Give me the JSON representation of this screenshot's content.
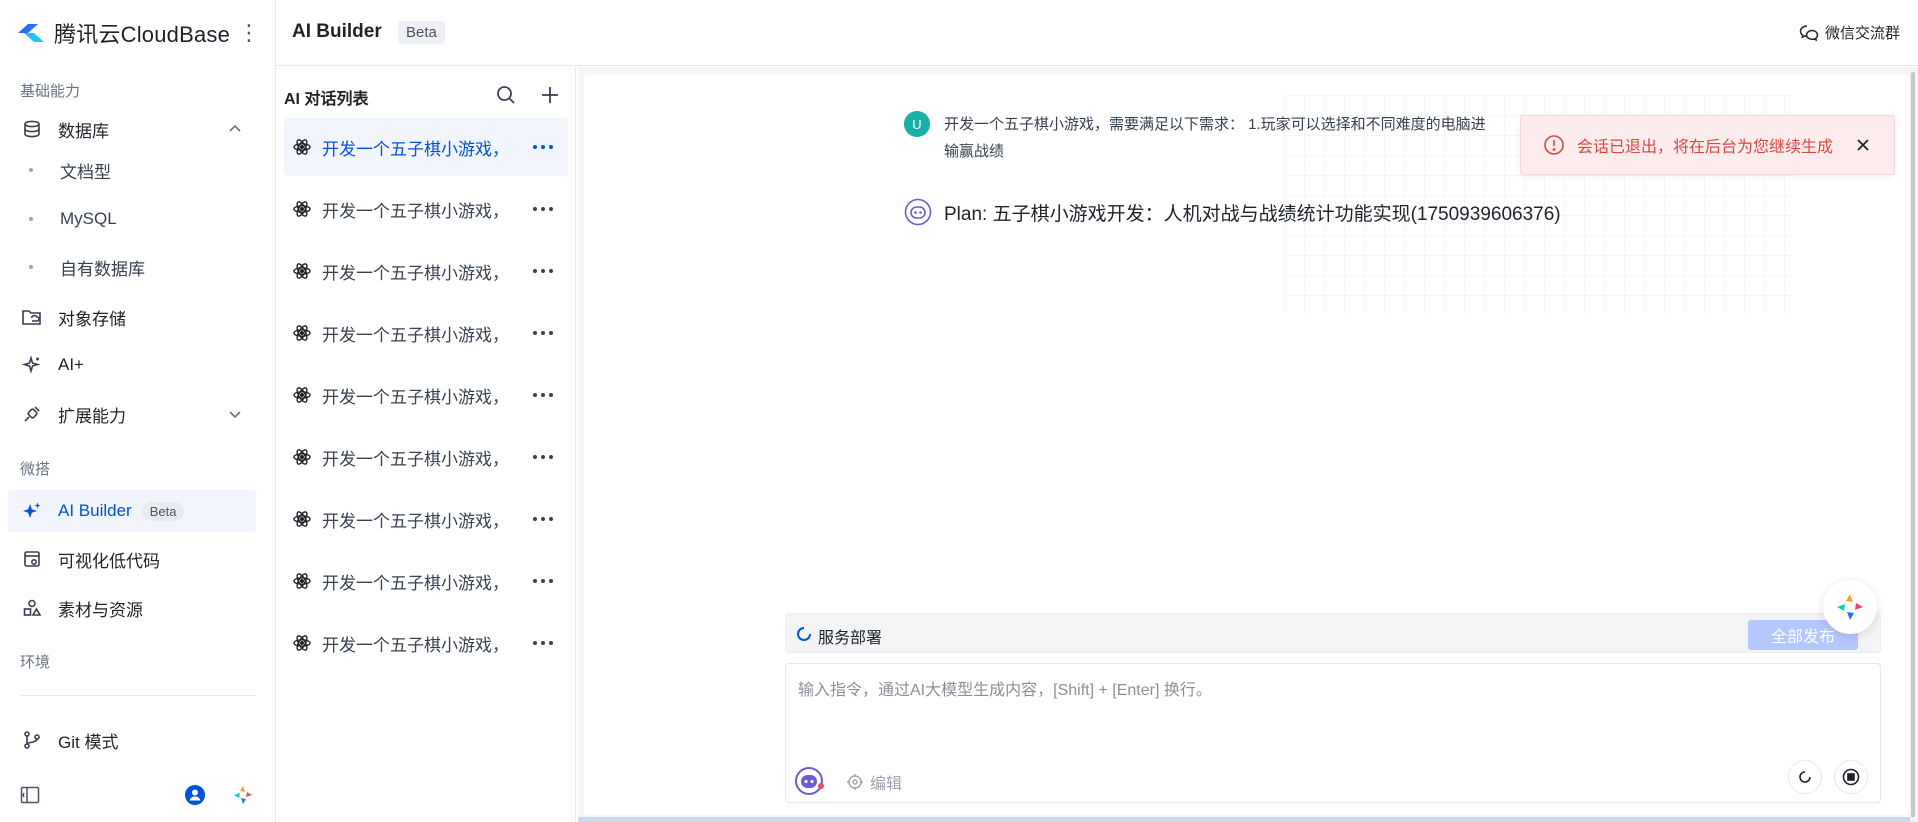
{
  "brand": {
    "name": "腾讯云CloudBase",
    "more_icon": "more-vertical-icon"
  },
  "sidebar": {
    "groups": {
      "base": "基础能力",
      "weida": "微搭",
      "env": "环境"
    },
    "items": [
      {
        "label": "数据库",
        "icon": "database-icon"
      },
      {
        "label": "文档型"
      },
      {
        "label": "MySQL"
      },
      {
        "label": "自有数据库"
      },
      {
        "label": "对象存储",
        "icon": "folder-cloud-icon"
      },
      {
        "label": "AI+",
        "icon": "sparkle-icon"
      },
      {
        "label": "扩展能力",
        "icon": "extension-icon"
      },
      {
        "label": "AI Builder",
        "badge": "Beta",
        "icon": "ai-sparkle-icon"
      },
      {
        "label": "可视化低代码",
        "icon": "lowcode-icon"
      },
      {
        "label": "素材与资源",
        "icon": "shapes-icon"
      },
      {
        "label": "Git 模式",
        "icon": "git-branch-icon"
      }
    ]
  },
  "header": {
    "title": "AI Builder",
    "badge": "Beta",
    "wechat": "微信交流群"
  },
  "conversations": {
    "title": "AI 对话列表",
    "items": [
      "开发一个五子棋小游戏，",
      "开发一个五子棋小游戏，",
      "开发一个五子棋小游戏，",
      "开发一个五子棋小游戏，",
      "开发一个五子棋小游戏，",
      "开发一个五子棋小游戏，",
      "开发一个五子棋小游戏，",
      "开发一个五子棋小游戏，",
      "开发一个五子棋小游戏，"
    ]
  },
  "chat": {
    "user_avatar": "U",
    "user_message_line1": "开发一个五子棋小游戏，需要满足以下需求： 1.玩家可以选择和不同难度的电脑进",
    "user_message_line2": "输赢战绩",
    "plan": "Plan: 五子棋小游戏开发：人机对战与战绩统计功能实现(1750939606376)",
    "toast": "会话已退出，将在后台为您继续生成",
    "deploy_label": "服务部署",
    "publish_label": "全部发布",
    "input_placeholder": "输入指令，通过AI大模型生成内容，[Shift] + [Enter] 换行。",
    "edit_label": "编辑"
  },
  "colors": {
    "accent": "#0052d9",
    "error": "#d54941",
    "publish_disabled": "#b5c7ff"
  }
}
